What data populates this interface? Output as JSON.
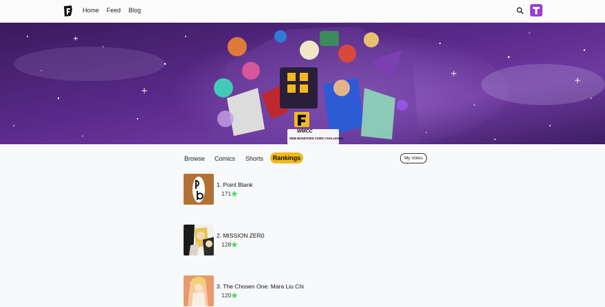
{
  "nav": {
    "links": [
      "Home",
      "Feed",
      "Blog"
    ],
    "avatar_letter": "T"
  },
  "banner": {
    "badge_title": "WMCC",
    "badge_subtitle": "WEB MONETIZED COMIC CHALLENGE"
  },
  "tabs": {
    "browse": "Browse",
    "comics": "Comics",
    "shorts": "Shorts",
    "rankings": "Rankings"
  },
  "my_votes_label": "My Votes",
  "rankings": [
    {
      "title": "1. Point Blank",
      "votes": "171"
    },
    {
      "title": "2. MISSION ZER0",
      "votes": "128"
    },
    {
      "title": "3. The Chosen One: Mara Liu Chi",
      "votes": "120"
    }
  ],
  "colors": {
    "accent": "#f4b81a",
    "brand_purple": "#9b3fcb",
    "star_green": "#4cd964"
  },
  "icons": {
    "logo": "f-logo-icon",
    "search": "search-icon",
    "star": "star-icon"
  }
}
